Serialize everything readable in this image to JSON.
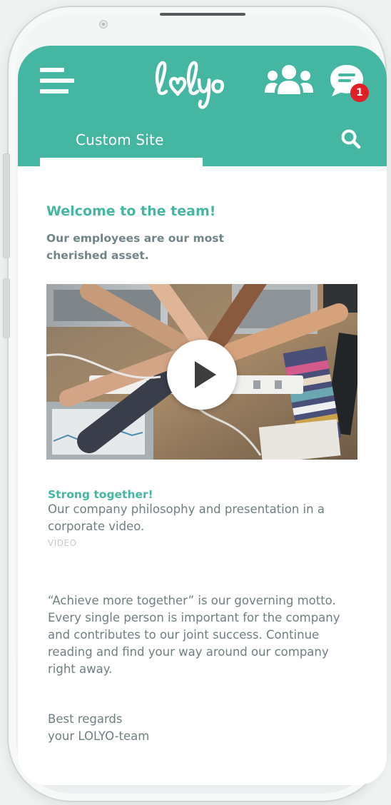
{
  "app": {
    "logo_text": "lolyo",
    "brand_color": "#45b6a1",
    "badge_color": "#e01f26"
  },
  "header": {
    "menu_icon": "hamburger-menu-icon",
    "team_icon": "team-icon",
    "chat_icon": "chat-icon",
    "chat_badge_count": "1",
    "search_icon": "search-icon"
  },
  "tabs": [
    {
      "label": "Custom Site",
      "active": true
    }
  ],
  "page": {
    "title": "Welcome to the team!",
    "subtitle": "Our employees are our most cherished asset.",
    "video": {
      "title": "Strong together!",
      "description": "Our company philosophy and presentation in a corporate video.",
      "tag": "VIDEO"
    },
    "body": "“Achieve more together” is our governing motto. Every single person is important for the company and contributes to our joint success. Continue reading and find your way around our company right away.",
    "signoff_line1": "Best regards",
    "signoff_line2": "your LOLYO-team"
  }
}
